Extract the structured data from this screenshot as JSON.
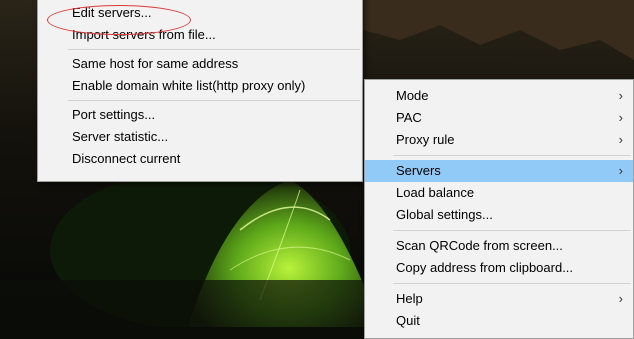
{
  "servers_submenu": {
    "items": [
      {
        "label": "Edit servers..."
      },
      {
        "label": "Import servers from file..."
      },
      {
        "label": "Same host for same address"
      },
      {
        "label": "Enable domain white list(http proxy only)"
      },
      {
        "label": "Port settings..."
      },
      {
        "label": "Server statistic..."
      },
      {
        "label": "Disconnect current"
      }
    ]
  },
  "main_menu": {
    "items": [
      {
        "label": "Mode",
        "submenu_icon": "chevron-right-icon"
      },
      {
        "label": "PAC",
        "submenu_icon": "chevron-right-icon"
      },
      {
        "label": "Proxy rule",
        "submenu_icon": "chevron-right-icon"
      },
      {
        "label": "Servers",
        "submenu_icon": "chevron-right-icon",
        "highlighted": true
      },
      {
        "label": "Load balance"
      },
      {
        "label": "Global settings..."
      },
      {
        "label": "Scan QRCode from screen..."
      },
      {
        "label": "Copy address from clipboard..."
      },
      {
        "label": "Help",
        "submenu_icon": "chevron-right-icon"
      },
      {
        "label": "Quit"
      }
    ],
    "arrow_glyph": "›"
  },
  "colors": {
    "menu_background": "#f2f2f2",
    "highlight": "#91c9f7",
    "annotation_circle": "#e0393a"
  }
}
